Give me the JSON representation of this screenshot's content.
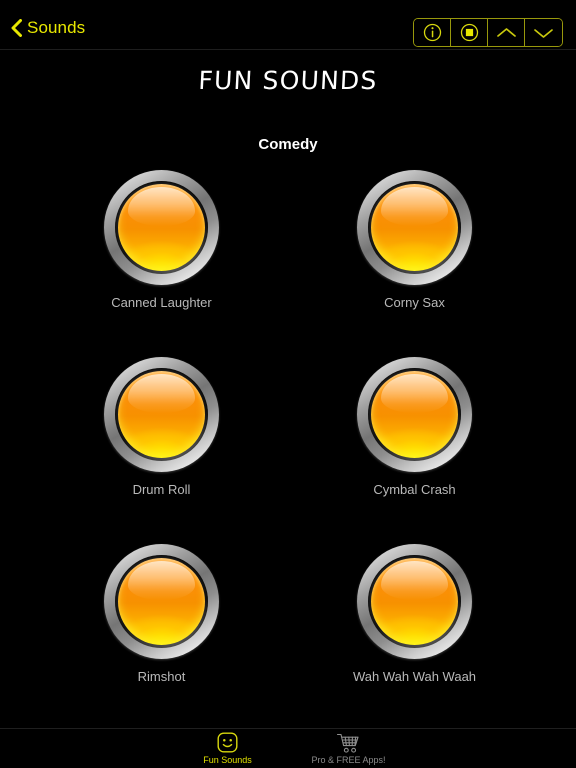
{
  "navbar": {
    "back_label": "Sounds",
    "back_icon": "chevron-left-icon",
    "accent_color": "#e8e800",
    "segmented": [
      {
        "name": "info-button",
        "icon": "info-circle-icon"
      },
      {
        "name": "stop-button",
        "icon": "stop-circle-icon"
      },
      {
        "name": "previous-button",
        "icon": "chevron-up-icon"
      },
      {
        "name": "next-button",
        "icon": "chevron-down-icon"
      }
    ]
  },
  "header": {
    "title": "FUN SOUNDS"
  },
  "main": {
    "section_title": "Comedy",
    "sounds": [
      {
        "label": "Canned Laughter"
      },
      {
        "label": "Corny Sax"
      },
      {
        "label": "Drum Roll"
      },
      {
        "label": "Cymbal Crash"
      },
      {
        "label": "Rimshot"
      },
      {
        "label": "Wah Wah Wah Waah"
      }
    ]
  },
  "tabbar": {
    "items": [
      {
        "label": "Fun Sounds",
        "icon": "smiley-face-icon",
        "active": true
      },
      {
        "label": "Pro & FREE Apps!",
        "icon": "shopping-cart-icon",
        "active": false
      }
    ]
  }
}
